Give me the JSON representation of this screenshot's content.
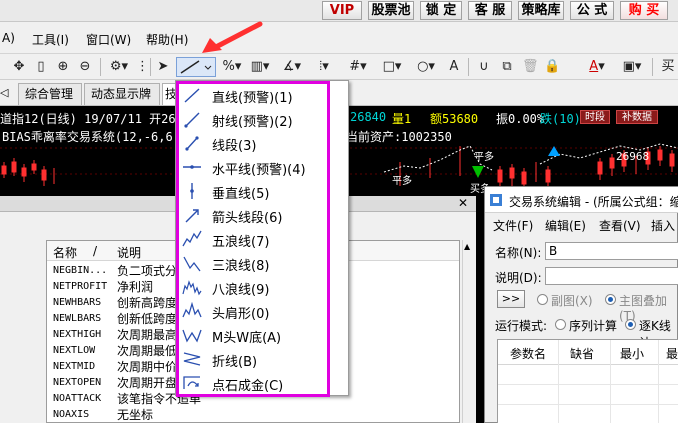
{
  "top_buttons": [
    {
      "label": "VIP",
      "style": "red"
    },
    {
      "label": "股票池",
      "style": "normal"
    },
    {
      "label": "锁 定",
      "style": "normal"
    },
    {
      "label": "客 服",
      "style": "normal"
    },
    {
      "label": "策略库",
      "style": "normal"
    },
    {
      "label": "公 式",
      "style": "normal"
    },
    {
      "label": "购 买",
      "style": "buy"
    }
  ],
  "menubar": [
    {
      "label": "A)"
    },
    {
      "label": "工具(I)"
    },
    {
      "label": "窗口(W)"
    },
    {
      "label": "帮助(H)"
    }
  ],
  "toolbar": {
    "draw_tools": "%",
    "buy_label": "买"
  },
  "tabs": [
    {
      "label": "综合管理"
    },
    {
      "label": "动态显示牌"
    },
    {
      "label": "技"
    }
  ],
  "chart": {
    "line1": "道指12(日线) 19/07/11 开268",
    "line2": "BIAS乖离率交易系统(12,-6,6",
    "quote_a": "26840",
    "quote_b": "量1",
    "quote_c": "额53680",
    "quote_d": "振0.00%",
    "quote_e": "跌(10)0.",
    "btn_time": "时段",
    "btn_restore": "补数据",
    "assets": "当前资产:1002350",
    "price_label": "26968",
    "mark_a": "平多",
    "mark_b": "平多",
    "mark_c": "买多"
  },
  "dropdown": {
    "items": [
      {
        "label": "直线(预警)(1)",
        "icon": "line-icon"
      },
      {
        "label": "射线(预警)(2)",
        "icon": "ray-icon"
      },
      {
        "label": "线段(3)",
        "icon": "segment-icon"
      },
      {
        "label": "水平线(预警)(4)",
        "icon": "horizontal-line-icon"
      },
      {
        "label": "垂直线(5)",
        "icon": "vertical-line-icon"
      },
      {
        "label": "箭头线段(6)",
        "icon": "arrow-segment-icon"
      },
      {
        "label": "五浪线(7)",
        "icon": "five-wave-icon"
      },
      {
        "label": "三浪线(8)",
        "icon": "three-wave-icon"
      },
      {
        "label": "八浪线(9)",
        "icon": "eight-wave-icon"
      },
      {
        "label": "头肩形(0)",
        "icon": "head-shoulders-icon"
      },
      {
        "label": "M头W底(A)",
        "icon": "m-top-w-bottom-icon"
      },
      {
        "label": "折线(B)",
        "icon": "polyline-icon"
      },
      {
        "label": "点石成金(C)",
        "icon": "gold-stone-icon"
      }
    ]
  },
  "left_list": {
    "col_name": "名称",
    "col_sort": "/",
    "col_desc": "说明",
    "rows": [
      {
        "name": "NEGBIN...",
        "desc": "负二项式分"
      },
      {
        "name": "NETPROFIT",
        "desc": "净利润"
      },
      {
        "name": "NEWHBARS",
        "desc": "创新高跨度"
      },
      {
        "name": "NEWLBARS",
        "desc": "创新低跨度"
      },
      {
        "name": "NEXTHIGH",
        "desc": "次周期最高"
      },
      {
        "name": "NEXTLOW",
        "desc": "次周期最低"
      },
      {
        "name": "NEXTMID",
        "desc": "次周期中价"
      },
      {
        "name": "NEXTOPEN",
        "desc": "次周期开盘"
      },
      {
        "name": "NOATTACK",
        "desc": "该笔指令不追单"
      },
      {
        "name": "NOAXIS",
        "desc": "无坐标"
      }
    ]
  },
  "editor": {
    "title": "交易系统编辑 - (所属公式组：缩",
    "menu": [
      "文件(F)",
      "编辑(E)",
      "查看(V)",
      "插入"
    ],
    "name_label": "名称(N):",
    "name_value": "B",
    "desc_label": "说明(D):",
    "expand_btn": ">>",
    "radio_sub": "副图(X)",
    "radio_main": "主图叠加(T)",
    "run_mode_label": "运行模式:",
    "radio_seq": "序列计算",
    "radio_step": "逐K线计",
    "table_headers": [
      "参数名",
      "缺省",
      "最小",
      "最"
    ]
  },
  "colors": {
    "accent_magenta": "#e000e0",
    "arrow_red": "#ff3030",
    "chart_red": "#ff3030",
    "chart_cyan": "#00d8d8",
    "chart_yellow": "#ffff00"
  }
}
